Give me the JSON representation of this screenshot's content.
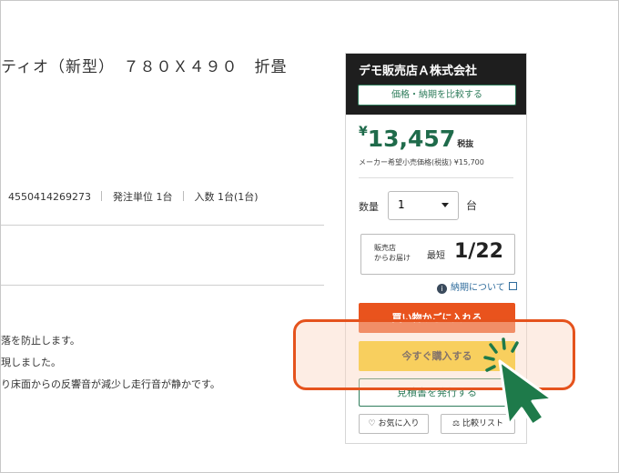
{
  "product": {
    "title": "ティオ（新型）　７８０Ｘ４９０　折畳",
    "jan": "4550414269273",
    "order_unit": "発注単位 1台",
    "quantity_in": "入数 1台(1台)",
    "description": [
      "落を防止します。",
      "現しました。",
      "り床面からの反響音が減少し走行音が静かです。"
    ]
  },
  "panel": {
    "shop_name": "デモ販売店Ａ株式会社",
    "compare_price_label": "価格・納期を比較する",
    "price_symbol": "¥",
    "price": "13,457",
    "price_tax_label": "税抜",
    "msrp": "メーカー希望小売価格(税抜) ¥15,700",
    "quantity_label": "数量",
    "quantity_value": "1",
    "quantity_unit": "台",
    "delivery_from_line1": "販売店",
    "delivery_from_line2": "からお届け",
    "delivery_shortest_label": "最短",
    "delivery_date": "1/22",
    "delivery_about_link": "納期について",
    "add_to_cart_label": "買い物かごに入れる",
    "buy_now_label": "今すぐ購入する",
    "quote_label": "見積書を発行する",
    "favorite_label": "お気に入り",
    "compare_list_label": "比較リスト"
  },
  "colors": {
    "header_bg": "#1e1e1e",
    "accent_green": "#1f6b4b",
    "cart_orange": "#e9531d",
    "buy_yellow": "#f6c80c",
    "highlight_orange": "#e5531d",
    "cursor_green": "#1e7a4a"
  },
  "icons": {
    "info": "info-icon",
    "external": "external-link-icon",
    "heart": "heart-icon",
    "scale": "scale-icon",
    "cursor": "pointer-cursor-icon"
  }
}
